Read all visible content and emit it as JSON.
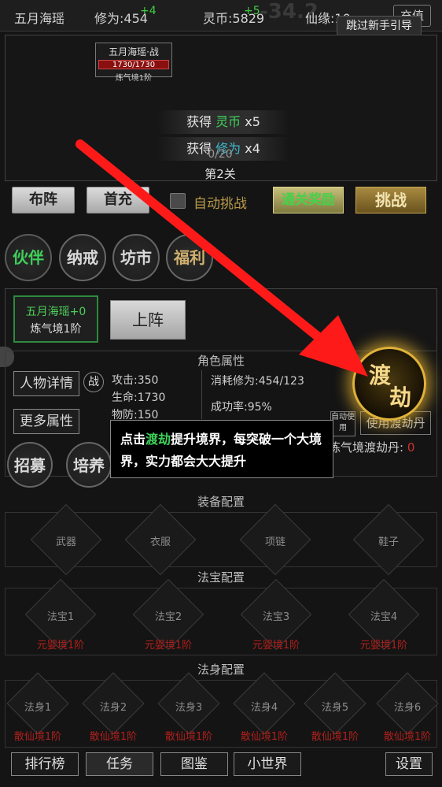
{
  "topbar": {
    "name": "五月海瑶",
    "cultivation": "修为:454",
    "cultivation_gain": "+4",
    "currency": "灵币:5829",
    "currency_gain": "+5",
    "fate": "仙缘:10",
    "right_btn": "充值",
    "float_number": "-34.2"
  },
  "skip_guide": "跳过新手引导",
  "battle": {
    "card_name": "五月海瑶·战",
    "card_hp": "1730/1730",
    "card_level": "炼气境1阶",
    "reward1_prefix": "获得",
    "reward1_item": "灵币",
    "reward1_count": "x5",
    "reward2_prefix": "获得",
    "reward2_item": "修为",
    "reward2_count": "x4",
    "wave": "0/20",
    "stage": "第2关"
  },
  "actions": {
    "formation": "布阵",
    "first_recharge": "首充",
    "auto_challenge": "自动挑战",
    "pass_reward": "通关奖励",
    "challenge": "挑战"
  },
  "tabs": [
    "伙伴",
    "纳戒",
    "坊市",
    "福利"
  ],
  "hero": {
    "name": "五月海瑶+0",
    "level": "炼气境1阶",
    "deploy": "上阵"
  },
  "attributes": {
    "section_title": "角色属性",
    "detail_btn": "人物详情",
    "battle_tag": "战",
    "more_btn": "更多属性",
    "attack": "攻击:350",
    "hp": "生命:1730",
    "defense": "物防:150",
    "cost": "消耗修为:454/123",
    "success": "成功率:95%",
    "recruit": "招募",
    "train": "培养"
  },
  "dujie": {
    "char1": "渡",
    "char2": "劫",
    "auto_use": "自动使用",
    "use_pill": "使用渡劫丹",
    "pill_label": "炼气境渡劫丹:",
    "pill_count": "0"
  },
  "tooltip": {
    "part1": "点击",
    "highlight": "渡劫",
    "part2": "提升境界，每突破一个大境界，实力都会大大提升"
  },
  "equipment": {
    "title": "装备配置",
    "slots": [
      "武器",
      "衣服",
      "项链",
      "鞋子"
    ]
  },
  "treasure": {
    "title": "法宝配置",
    "slots": [
      "法宝1",
      "法宝2",
      "法宝3",
      "法宝4"
    ],
    "requirement": "元婴境1阶"
  },
  "body": {
    "title": "法身配置",
    "slots": [
      "法身1",
      "法身2",
      "法身3",
      "法身4",
      "法身5",
      "法身6"
    ],
    "requirement": "散仙境1阶"
  },
  "bottom_nav": [
    "排行榜",
    "任务",
    "图鉴",
    "小世界",
    "设置"
  ],
  "colors": {
    "accent_green": "#3fd05a",
    "arrow_red": "#ff1a1a",
    "gold": "#e0b23a",
    "warn_red": "#b0201c"
  }
}
